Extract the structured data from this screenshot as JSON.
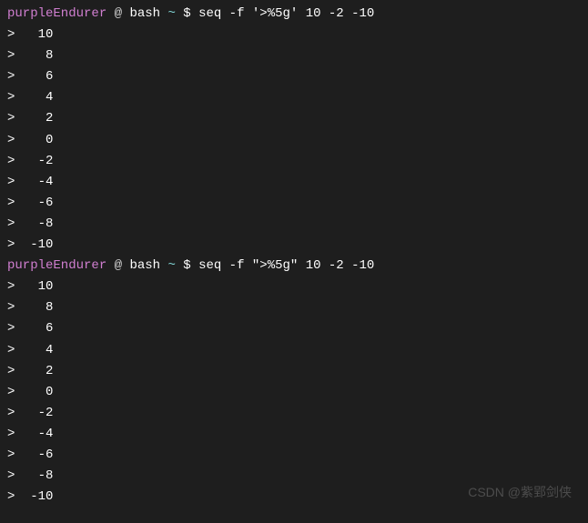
{
  "prompt1": {
    "user": "purpleEndurer",
    "at": " @ ",
    "shell": "bash",
    "path": " ~ ",
    "dollar": "$ ",
    "command": "seq -f '>%5g' 10 -2 -10"
  },
  "output1": [
    ">   10",
    ">    8",
    ">    6",
    ">    4",
    ">    2",
    ">    0",
    ">   -2",
    ">   -4",
    ">   -6",
    ">   -8",
    ">  -10"
  ],
  "prompt2": {
    "user": "purpleEndurer",
    "at": " @ ",
    "shell": "bash",
    "path": " ~ ",
    "dollar": "$ ",
    "command": "seq -f \">%5g\" 10 -2 -10"
  },
  "output2": [
    ">   10",
    ">    8",
    ">    6",
    ">    4",
    ">    2",
    ">    0",
    ">   -2",
    ">   -4",
    ">   -6",
    ">   -8",
    ">  -10"
  ],
  "watermark": "CSDN @紫郢剑侠"
}
